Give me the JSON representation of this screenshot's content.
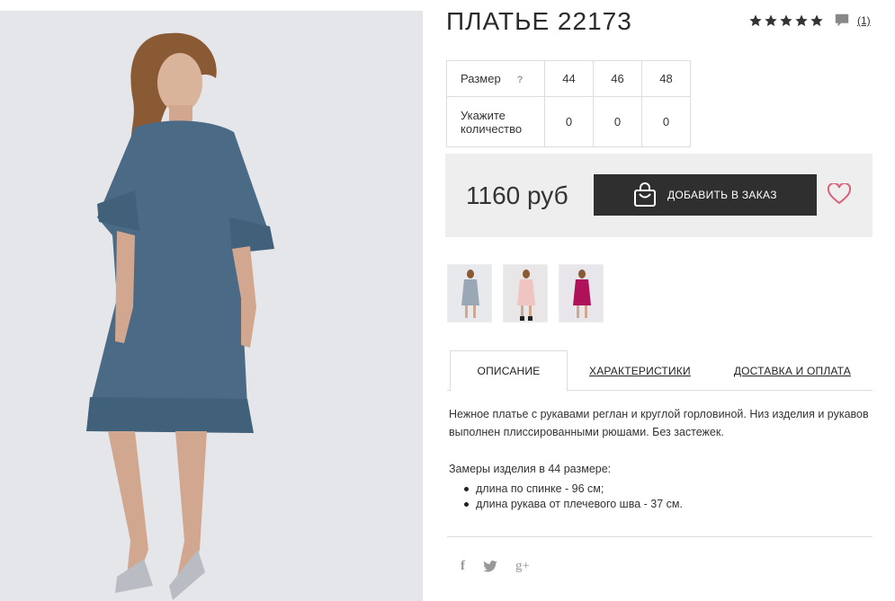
{
  "product": {
    "title": "ПЛАТЬЕ 22173",
    "rating_stars": 5,
    "review_count": "(1)"
  },
  "sizes_table": {
    "size_label": "Размер",
    "help_mark": "?",
    "sizes": [
      "44",
      "46",
      "48"
    ],
    "qty_label_line1": "Укажите",
    "qty_label_line2": "количество",
    "quantities": [
      "0",
      "0",
      "0"
    ]
  },
  "purchase": {
    "price": "1160 руб",
    "add_to_order_label": "ДОБАВИТЬ В ЗАКАЗ"
  },
  "colors": {
    "dress_main": "#4a6a86",
    "price_box_bg": "#eeeeee",
    "button_bg": "#2f2f2f",
    "heart": "#d9607b"
  },
  "thumbnails": [
    {
      "icon": "dress-grey-thumbnail"
    },
    {
      "icon": "dress-pink-thumbnail"
    },
    {
      "icon": "dress-magenta-thumbnail"
    }
  ],
  "tabs": {
    "description": "ОПИСАНИЕ",
    "characteristics": "ХАРАКТЕРИСТИКИ",
    "delivery": "ДОСТАВКА И ОПЛАТА"
  },
  "description": {
    "text": "Нежное платье с рукавами реглан и круглой горловиной. Низ изделия и рукавов выполнен плиссированными рюшами. Без застежек.",
    "measures_title": "Замеры изделия в 44 размере:",
    "measures": [
      "длина по спинке - 96 см;",
      "длина рукава от плечевого шва - 37 см."
    ]
  },
  "social": {
    "facebook": "f",
    "twitter": "twitter-icon",
    "gplus": "g+"
  }
}
